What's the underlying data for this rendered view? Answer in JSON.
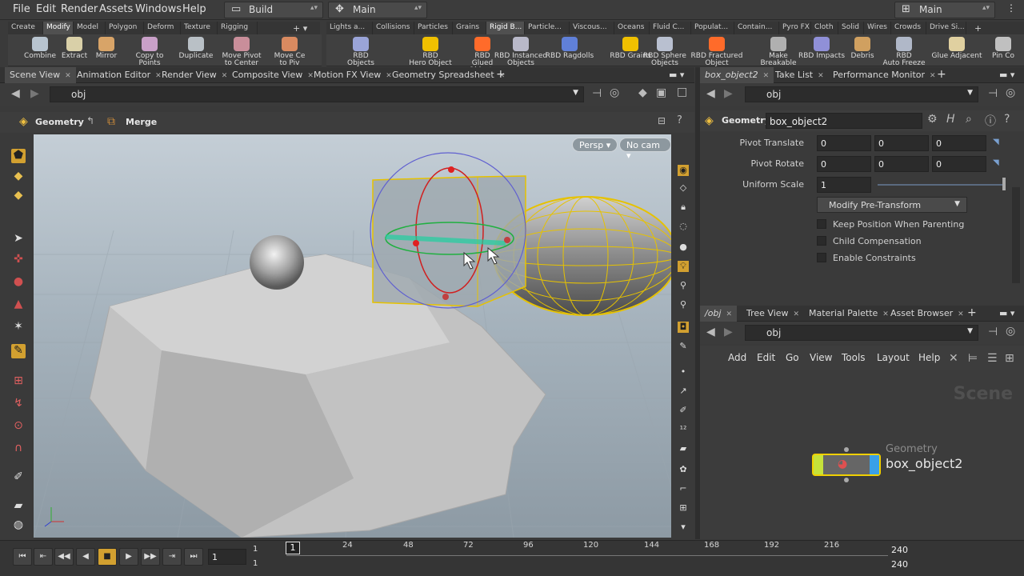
{
  "menubar": {
    "items": [
      "File",
      "Edit",
      "Render",
      "Assets",
      "Windows",
      "Help"
    ],
    "desktop": "Build",
    "network": "Main",
    "right_desktop": "Main"
  },
  "shelf_left": {
    "tabs": [
      "Create",
      "Modify",
      "Model",
      "Polygon",
      "Deform",
      "Texture",
      "Rigging"
    ],
    "active": "Modify",
    "tools": [
      {
        "label1": "Combine",
        "label2": ""
      },
      {
        "label1": "Extract",
        "label2": ""
      },
      {
        "label1": "Mirror",
        "label2": ""
      },
      {
        "label1": "Copy to Points",
        "label2": ""
      },
      {
        "label1": "Duplicate",
        "label2": ""
      },
      {
        "label1": "Move Pivot",
        "label2": "to Center"
      },
      {
        "label1": "Move Ce",
        "label2": "to Piv"
      }
    ]
  },
  "shelf_right": {
    "tabs": [
      "Lights a...",
      "Collisions",
      "Particles",
      "Grains",
      "Rigid B...",
      "Particle...",
      "Viscous...",
      "Oceans",
      "Fluid C...",
      "Populat...",
      "Contain...",
      "Pyro FX",
      "Cloth",
      "Solid",
      "Wires",
      "Crowds",
      "Drive Si..."
    ],
    "active": "Rigid B...",
    "tools": [
      {
        "label1": "RBD Objects",
        "label2": ""
      },
      {
        "label1": "RBD",
        "label2": "Hero Object"
      },
      {
        "label1": "RBD",
        "label2": "Glued Objects"
      },
      {
        "label1": "RBD Instanced",
        "label2": "Objects"
      },
      {
        "label1": "RBD Ragdolls",
        "label2": ""
      },
      {
        "label1": "RBD Grains",
        "label2": ""
      },
      {
        "label1": "RBD Sphere",
        "label2": "Objects"
      },
      {
        "label1": "RBD Fractured",
        "label2": "Object"
      },
      {
        "label1": "Make",
        "label2": "Breakable"
      },
      {
        "label1": "RBD Impacts",
        "label2": ""
      },
      {
        "label1": "Debris",
        "label2": ""
      },
      {
        "label1": "RBD",
        "label2": "Auto Freeze"
      },
      {
        "label1": "Glue Adjacent",
        "label2": ""
      },
      {
        "label1": "Pin Co",
        "label2": ""
      }
    ]
  },
  "viewer": {
    "tabs": [
      "Scene View",
      "Animation Editor",
      "Render View",
      "Composite View",
      "Motion FX View",
      "Geometry Spreadsheet"
    ],
    "path": "obj",
    "context": "Geometry",
    "state": "Merge",
    "persp": "Persp",
    "cam": "No cam"
  },
  "params": {
    "tabs": [
      "box_object2",
      "Take List",
      "Performance Monitor"
    ],
    "path": "obj",
    "type": "Geometry",
    "node_name": "box_object2",
    "pivot_translate_label": "Pivot Translate",
    "pivot_translate": [
      "0",
      "0",
      "0"
    ],
    "pivot_rotate_label": "Pivot Rotate",
    "pivot_rotate": [
      "0",
      "0",
      "0"
    ],
    "uniform_scale_label": "Uniform Scale",
    "uniform_scale": "1",
    "modify_button": "Modify Pre-Transform",
    "checks": [
      "Keep Position When Parenting",
      "Child Compensation",
      "Enable Constraints"
    ]
  },
  "network": {
    "tabs": [
      "/obj",
      "Tree View",
      "Material Palette",
      "Asset Browser"
    ],
    "path": "obj",
    "menu": [
      "Add",
      "Edit",
      "Go",
      "View",
      "Tools",
      "Layout",
      "Help"
    ],
    "watermark": "Scene",
    "node_type": "Geometry",
    "node_name": "box_object2"
  },
  "timeline": {
    "start": "1",
    "start2": "1",
    "current": "1",
    "end": "240",
    "end2": "240",
    "frame_field": "1",
    "ticks": [
      "24",
      "48",
      "72",
      "96",
      "120",
      "144",
      "168",
      "192",
      "216"
    ]
  },
  "colors": {
    "accent": "#f2c200",
    "node": "#c6e23a",
    "panel": "#3a3a3a"
  }
}
